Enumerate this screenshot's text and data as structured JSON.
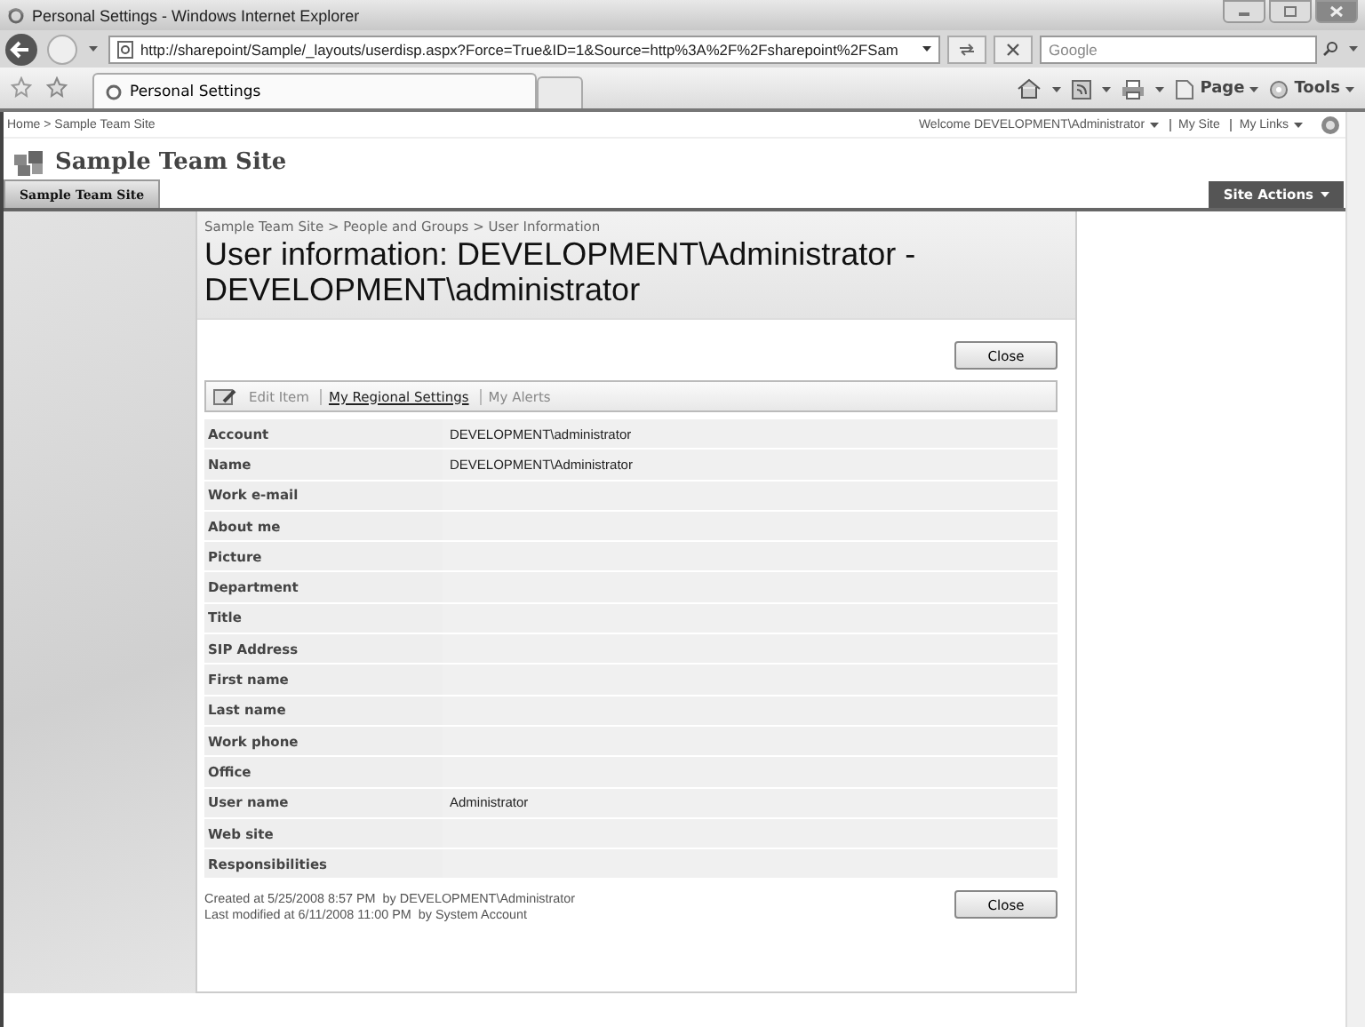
{
  "window": {
    "title": "Personal Settings - Windows Internet Explorer"
  },
  "address_bar": {
    "url": "http://sharepoint/Sample/_layouts/userdisp.aspx?Force=True&ID=1&Source=http%3A%2F%2Fsharepoint%2FSam"
  },
  "search": {
    "placeholder": "Google"
  },
  "browser_tabs": [
    {
      "label": "Personal Settings",
      "selected": true
    }
  ],
  "command_bar": [
    "Page",
    "Tools"
  ],
  "page": {
    "breadcrumb": "Home > Sample Team Site",
    "welcome": "Welcome DEVELOPMENT\\Administrator",
    "top_links": [
      "My Site",
      "My Links"
    ],
    "site_title": "Sample Team Site",
    "nav_tabs": [
      {
        "label": "Sample Team Site",
        "selected": true
      }
    ],
    "site_actions": "Site Actions",
    "content_breadcrumb": "Sample Team Site > People and Groups > User Information",
    "heading": "User information: DEVELOPMENT\\Administrator - DEVELOPMENT\\administrator",
    "close_button": "Close",
    "toolbar": [
      {
        "label": "Edit Item",
        "disabled": true
      },
      {
        "label": "My Regional Settings",
        "disabled": false
      },
      {
        "label": "My Alerts",
        "disabled": true
      }
    ],
    "fields": [
      {
        "label": "Account",
        "value": "DEVELOPMENT\\administrator"
      },
      {
        "label": "Name",
        "value": "DEVELOPMENT\\Administrator"
      },
      {
        "label": "Work e-mail"
      },
      {
        "label": "About me"
      },
      {
        "label": "Picture"
      },
      {
        "label": "Department"
      },
      {
        "label": "Title"
      },
      {
        "label": "SIP Address"
      },
      {
        "label": "First name"
      },
      {
        "label": "Last name"
      },
      {
        "label": "Work phone"
      },
      {
        "label": "Office"
      },
      {
        "label": "User name",
        "value": "Administrator"
      },
      {
        "label": "Web site"
      },
      {
        "label": "Responsibilities"
      }
    ],
    "created": "Created at 5/25/2008 8:57 PM  by DEVELOPMENT\\Administrator",
    "modified": "Last modified at 6/11/2008 11:00 PM  by System Account",
    "footer_close_button": "Close"
  }
}
